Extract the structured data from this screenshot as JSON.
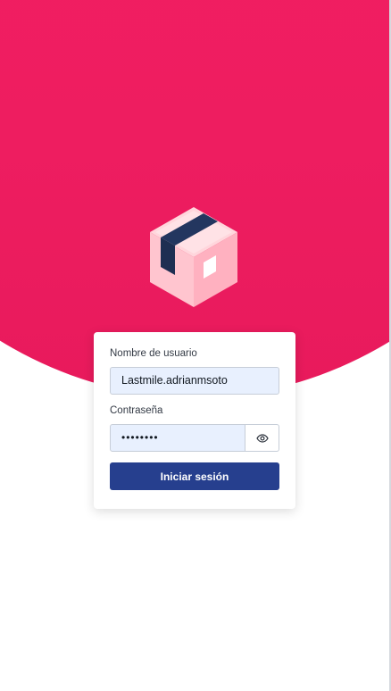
{
  "login": {
    "username_label": "Nombre de usuario",
    "username_value": "Lastmile.adrianmsoto",
    "password_label": "Contraseña",
    "password_value": "••••••••",
    "submit_label": "Iniciar sesión"
  },
  "icons": {
    "logo": "package-box-icon",
    "toggle": "eye-icon"
  },
  "colors": {
    "brand_pink": "#f81f66",
    "primary_button": "#263f8e",
    "input_fill": "#e8f0fe"
  }
}
